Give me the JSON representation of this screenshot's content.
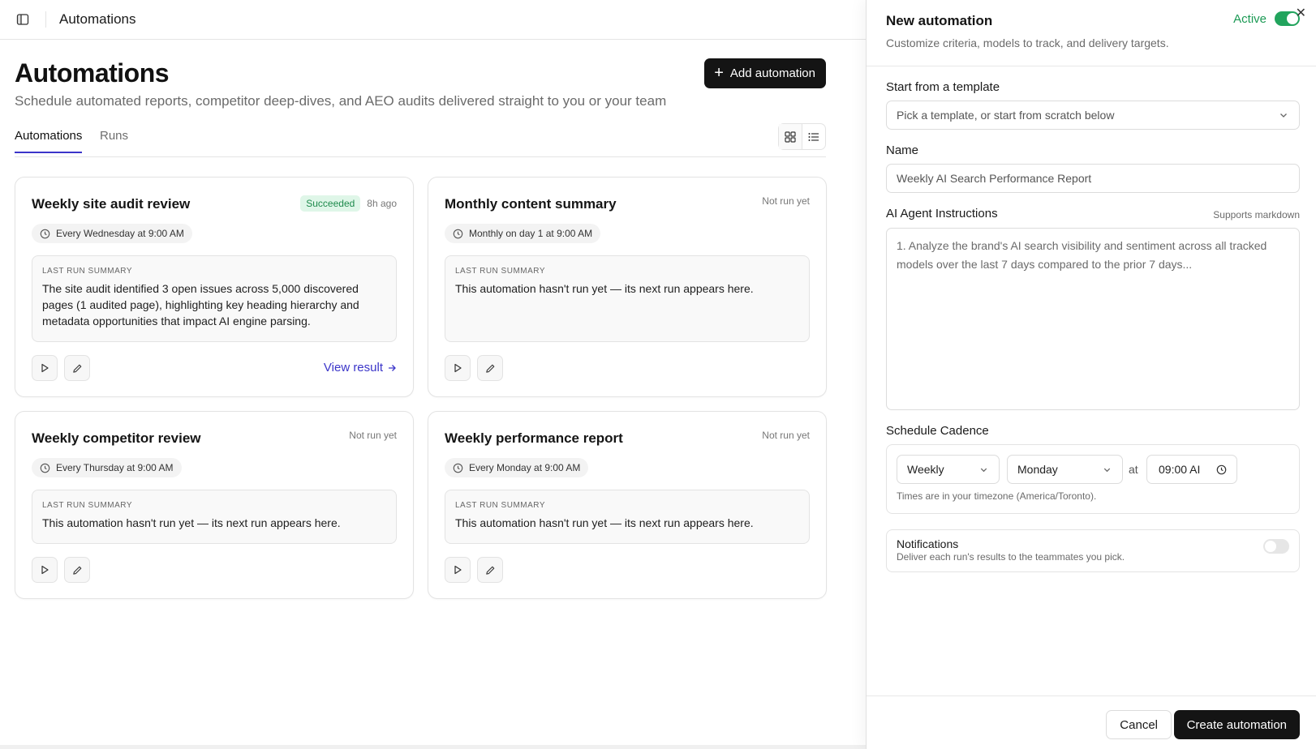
{
  "topbar": {
    "breadcrumb": "Automations",
    "sidebar_icon": "sidebar-toggle-icon"
  },
  "header": {
    "title": "Automations",
    "subtitle": "Schedule automated reports, competitor deep-dives, and AEO audits delivered straight to you or your team",
    "add_button": "Add automation"
  },
  "tabs": [
    {
      "label": "Automations",
      "active": true
    },
    {
      "label": "Runs",
      "active": false
    }
  ],
  "cards": [
    {
      "title": "Weekly site audit review",
      "badge": "Succeeded",
      "status": "8h ago",
      "schedule": "Every Wednesday at 9:00 AM",
      "summary_label": "LAST RUN SUMMARY",
      "summary": "The site audit identified 3 open issues across 5,000 discovered pages (1 audited page), highlighting key heading hierarchy and metadata opportunities that impact AI engine parsing.",
      "view_result": "View result"
    },
    {
      "title": "Monthly content summary",
      "badge": "",
      "status": "Not run yet",
      "schedule": "Monthly on day 1 at 9:00 AM",
      "summary_label": "LAST RUN SUMMARY",
      "summary": "This automation hasn't run yet — its next run appears here.",
      "view_result": ""
    },
    {
      "title": "Weekly competitor review",
      "badge": "",
      "status": "Not run yet",
      "schedule": "Every Thursday at 9:00 AM",
      "summary_label": "LAST RUN SUMMARY",
      "summary": "This automation hasn't run yet — its next run appears here.",
      "view_result": ""
    },
    {
      "title": "Weekly performance report",
      "badge": "",
      "status": "Not run yet",
      "schedule": "Every Monday at 9:00 AM",
      "summary_label": "LAST RUN SUMMARY",
      "summary": "This automation hasn't run yet — its next run appears here.",
      "view_result": ""
    }
  ],
  "panel": {
    "title": "New automation",
    "subtitle": "Customize criteria, models to track, and delivery targets.",
    "active_label": "Active",
    "template_label": "Start from a template",
    "template_placeholder": "Pick a template, or start from scratch below",
    "name_label": "Name",
    "name_value": "Weekly AI Search Performance Report",
    "instructions_label": "AI Agent Instructions",
    "instructions_hint": "Supports markdown",
    "instructions_value": "1. Analyze the brand's AI search visibility and sentiment across all tracked models over the last 7 days compared to the prior 7 days...",
    "schedule_label": "Schedule Cadence",
    "frequency": "Weekly",
    "weekday": "Monday",
    "at_label": "at",
    "time": "09:00 AI",
    "timezone_note": "Times are in your timezone (America/Toronto).",
    "notifications_title": "Notifications",
    "notifications_sub": "Deliver each run's results to the teammates you pick.",
    "cancel": "Cancel",
    "create": "Create automation"
  },
  "colors": {
    "accent": "#3b35c9",
    "success": "#22a45d",
    "primary_button": "#141414"
  }
}
